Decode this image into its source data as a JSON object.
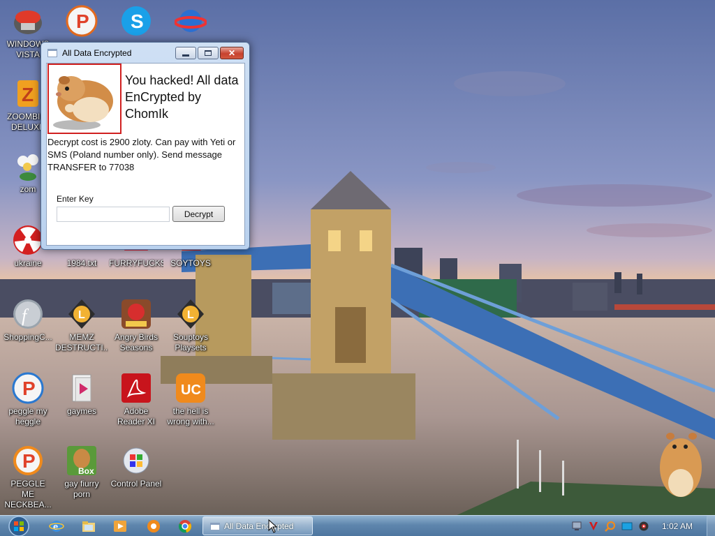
{
  "desktop": {
    "icons": [
      {
        "label": "WINDOWS VISTA"
      },
      {
        "label": "ZOOMBINIS DELUXE"
      },
      {
        "label": "zom"
      },
      {
        "label": "ukraine"
      },
      {
        "label": "1984.txt"
      },
      {
        "label": "FURRYFUCKS"
      },
      {
        "label": "SOYTOYS"
      },
      {
        "label": "ShoppingC..."
      },
      {
        "label": "MEMZ DESTRUCTI..."
      },
      {
        "label": "Angry Birds Seasons"
      },
      {
        "label": "Souptoys Playsets"
      },
      {
        "label": "peggle my heggle"
      },
      {
        "label": "gaymes"
      },
      {
        "label": "Adobe Reader XI"
      },
      {
        "label": "the hell is wrong with..."
      },
      {
        "label": "PEGGLE ME NECKBEA..."
      },
      {
        "label": "gay fiurry porn"
      },
      {
        "label": "Control Panel"
      }
    ]
  },
  "dialog": {
    "title": "All Data Encrypted",
    "headline": "You hacked! All data EnCrypted by ChomIk",
    "message": "Decrypt cost is 2900 zloty. Can pay with Yeti or SMS (Poland number only). Send message TRANSFER to 77038",
    "key_label": "Enter Key",
    "key_value": "",
    "decrypt_label": "Decrypt",
    "close_glyph": "✕"
  },
  "taskbar": {
    "active_task": "All Data Encrypted",
    "clock": "1:02 AM",
    "pinned": [
      "internet-explorer-icon",
      "file-explorer-icon",
      "media-player-icon",
      "uc-browser-icon",
      "chrome-icon"
    ]
  },
  "colors": {
    "dialog_border_accent": "#d02020",
    "close_button": "#c7422e",
    "taskbar": "#5f86ad"
  }
}
